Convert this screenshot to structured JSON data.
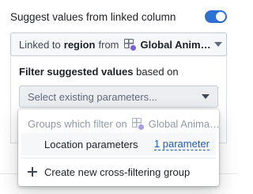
{
  "toggle": {
    "label": "Suggest values from linked column",
    "on": true
  },
  "linked": {
    "prefix": "Linked to",
    "column": "region",
    "connector": "from",
    "object_icon": "object-type-icon",
    "object_name": "Global Anim…"
  },
  "filter": {
    "title_bold": "Filter suggested values",
    "title_rest": "based on",
    "select_placeholder": "Select existing parameters..."
  },
  "menu": {
    "header_prefix": "Groups which filter on",
    "header_object": "Global Anima…",
    "groups": [
      {
        "label": "Location parameters",
        "count_label": "1 parameter"
      }
    ],
    "create_label": "Create new cross-filtering group",
    "create_icon": "plus-icon"
  },
  "colors": {
    "accent": "#2d72d2",
    "link": "#215db0",
    "object_badge": "#7961db"
  }
}
